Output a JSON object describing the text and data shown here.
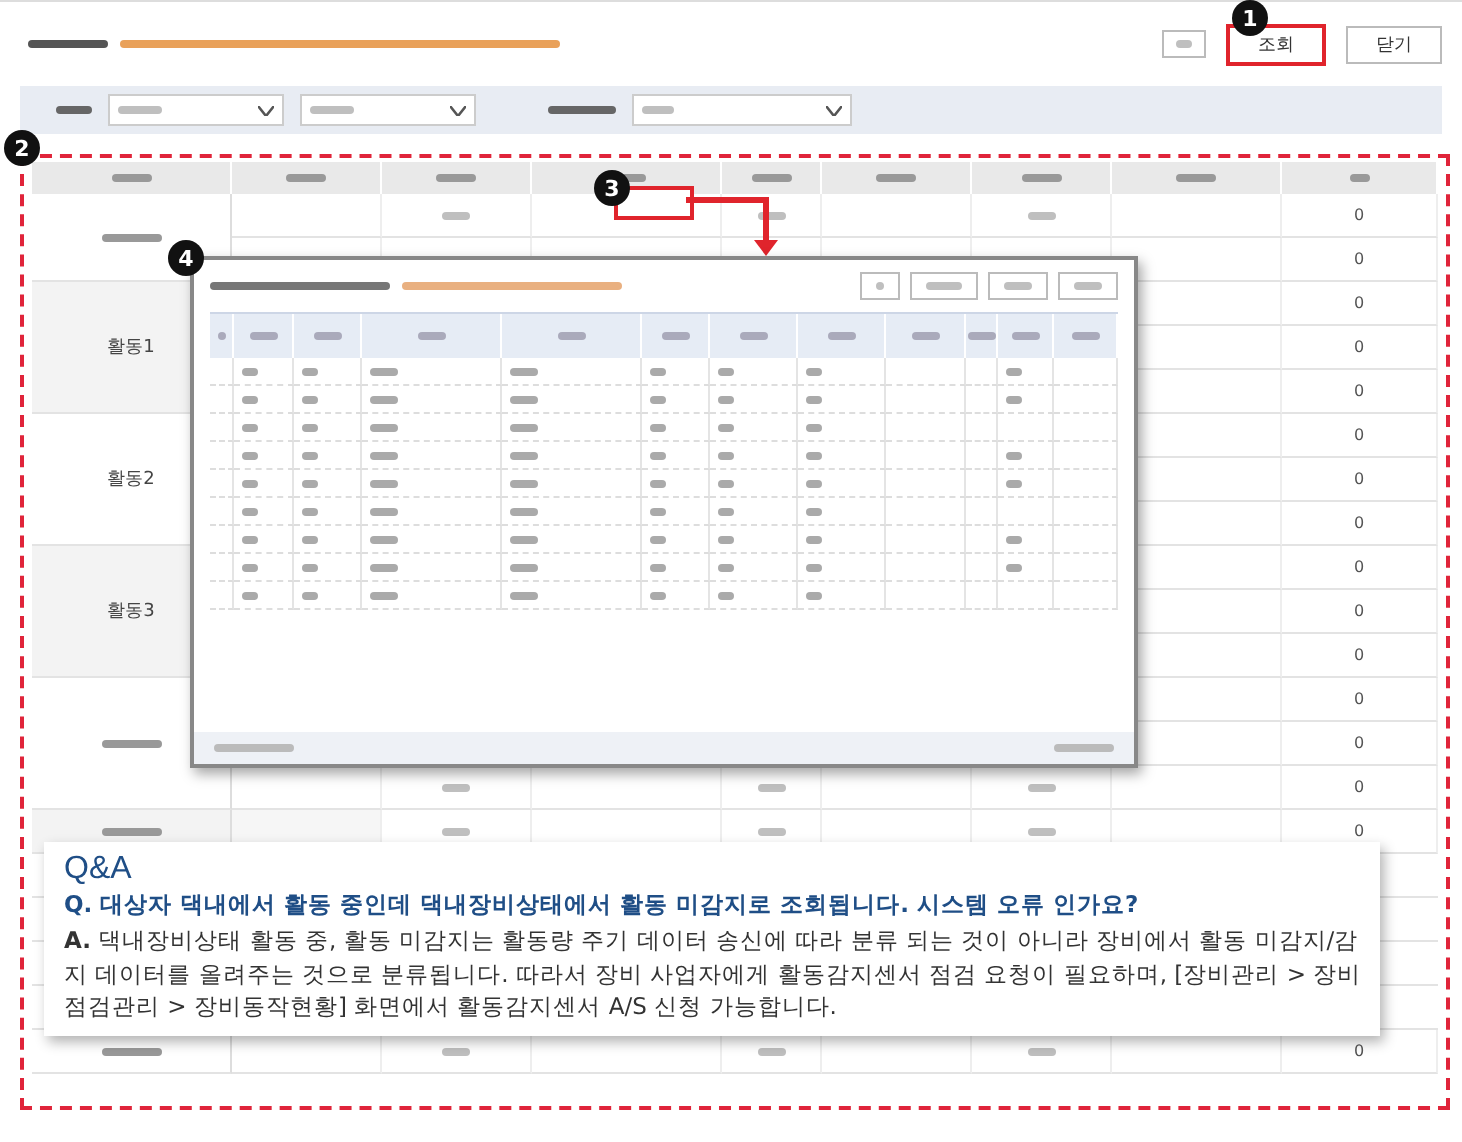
{
  "header": {
    "buttons": [
      {
        "label": "조회",
        "highlighted": true
      },
      {
        "label": "닫기",
        "highlighted": false
      }
    ]
  },
  "markers": [
    "1",
    "2",
    "3",
    "4"
  ],
  "table": {
    "groups": [
      {
        "values": [
          "0",
          "0"
        ]
      },
      {
        "label": "활동1",
        "values": [
          "0",
          "0",
          "0"
        ]
      },
      {
        "label": "활동2",
        "values": [
          "0",
          "0",
          "0"
        ]
      },
      {
        "label": "활동3",
        "values": [
          "0",
          "0",
          "0"
        ]
      },
      {
        "values": [
          "0",
          "0",
          "0"
        ]
      },
      {
        "values": [
          "0"
        ]
      },
      {
        "values": [
          "0"
        ]
      }
    ]
  },
  "qa": {
    "title": "Q&A",
    "question": "Q. 대상자 댁내에서 활동 중인데 댁내장비상태에서 활동 미감지로 조회됩니다. 시스템 오류 인가요?",
    "answer": "**A.** 댁내장비상태 활동 중, 활동 미감지는 활동량 주기 데이터 송신에 따라 분류 되는 것이 아니라 장비에서 활동 미감지/감지 데이터를 올려주는 것으로 분류됩니다. 따라서 장비 사업자에게 활동감지센서 점검 요청이 필요하며, [장비관리 > 장비 점검관리 > 장비동작현황] 화면에서 활동감지센서 A/S 신청 가능합니다."
  }
}
